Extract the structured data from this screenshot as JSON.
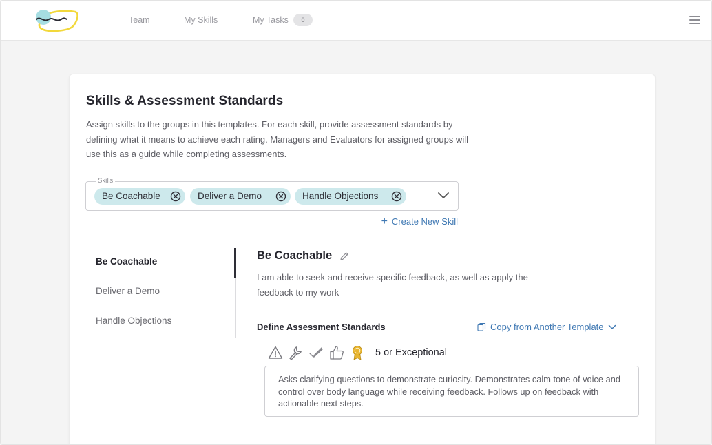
{
  "nav": {
    "links": [
      "Team",
      "My Skills",
      "My Tasks"
    ],
    "tasks_count": "0"
  },
  "page": {
    "title": "Skills & Assessment Standards",
    "description": "Assign skills to the groups in this templates. For each skill, provide assessment standards by defining what it means to achieve each rating. Managers and Evaluators for assigned groups will use this as a guide while completing assessments."
  },
  "skills_field": {
    "label": "Skills",
    "chips": [
      "Be Coachable",
      "Deliver a Demo",
      "Handle Objections"
    ]
  },
  "create_skill": "Create New Skill",
  "skill_list": [
    "Be Coachable",
    "Deliver a Demo",
    "Handle Objections"
  ],
  "detail": {
    "title": "Be Coachable",
    "description": "I am able to seek and receive specific feedback, as well as apply the feedback to my work",
    "define_label": "Define Assessment Standards",
    "copy_label": "Copy from Another Template",
    "rating_icons": [
      "warning-icon",
      "wrench-icon",
      "check-icon",
      "thumbs-up-icon",
      "award-icon"
    ],
    "selected_rating": "5 or Exceptional",
    "standard_text": "Asks clarifying questions to demonstrate curiosity. Demonstrates calm tone of voice and control over body language while receiving feedback. Follows up on feedback with actionable next steps."
  },
  "colors": {
    "accent": "#3f78b3",
    "chip_bg": "#cde9ec",
    "award": "#e8b531"
  }
}
